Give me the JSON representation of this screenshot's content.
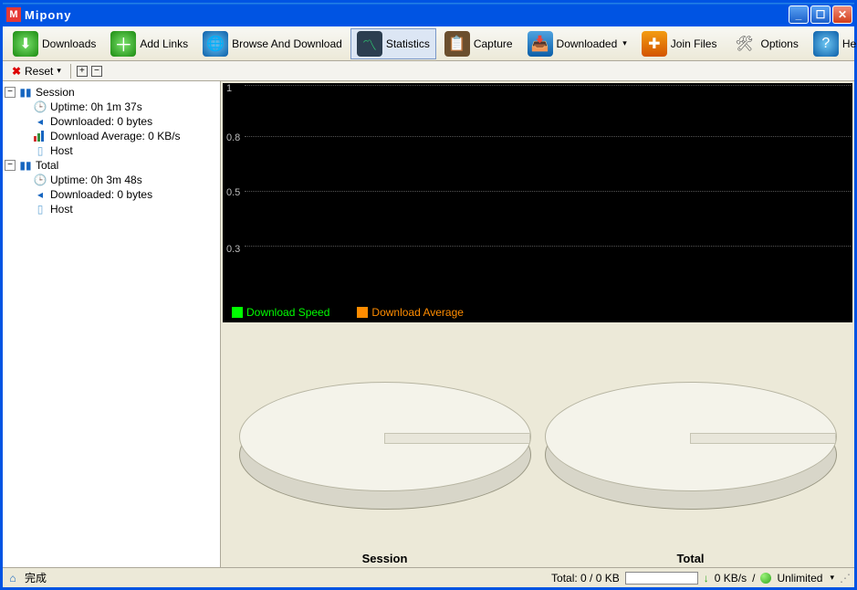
{
  "window": {
    "title": "Mipony"
  },
  "toolbar": {
    "downloads": "Downloads",
    "addlinks": "Add Links",
    "browse": "Browse And Download",
    "statistics": "Statistics",
    "capture": "Capture",
    "downloaded": "Downloaded",
    "joinfiles": "Join Files",
    "options": "Options",
    "help": "Help"
  },
  "secondary": {
    "reset": "Reset"
  },
  "tree": {
    "session": {
      "label": "Session",
      "uptime": "Uptime: 0h 1m 37s",
      "downloaded": "Downloaded: 0 bytes",
      "avg": "Download Average: 0 KB/s",
      "host": "Host"
    },
    "total": {
      "label": "Total",
      "uptime": "Uptime: 0h 3m 48s",
      "downloaded": "Downloaded: 0 bytes",
      "host": "Host"
    }
  },
  "chart": {
    "legend_speed": "Download Speed",
    "legend_avg": "Download Average",
    "legend_speed_color": "#00ff00",
    "legend_avg_color": "#ff8c00",
    "yticks": [
      "1",
      "0.8",
      "0.5",
      "0.3"
    ]
  },
  "chart_data": {
    "type": "line",
    "title": "",
    "xlabel": "",
    "ylabel": "",
    "ylim": [
      0,
      1
    ],
    "yticks": [
      0.3,
      0.5,
      0.8,
      1.0
    ],
    "x": [],
    "series": [
      {
        "name": "Download Speed",
        "color": "#00ff00",
        "values": []
      },
      {
        "name": "Download Average",
        "color": "#ff8c00",
        "values": []
      }
    ]
  },
  "pies": {
    "session": "Session",
    "total": "Total"
  },
  "status": {
    "left": "完成",
    "total": "Total: 0 / 0 KB",
    "speed": "0 KB/s",
    "slash": "/",
    "limit": "Unlimited"
  }
}
